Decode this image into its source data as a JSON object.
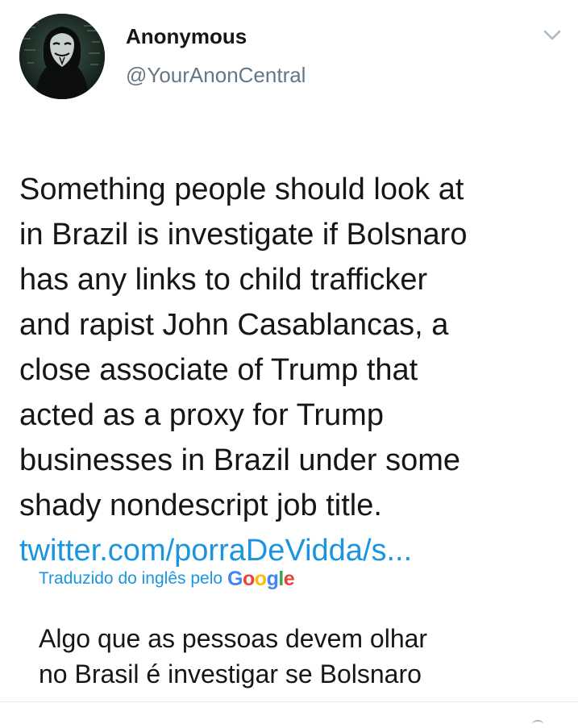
{
  "author": {
    "display_name": "Anonymous",
    "handle": "@YourAnonCentral",
    "avatar_icon": "anonymous-mask-avatar"
  },
  "menu": {
    "icon": "chevron-down-icon"
  },
  "tweet": {
    "text": "Something people should look at\nin Brazil is investigate if Bolsnaro\nhas any links to child trafficker\nand rapist John Casablancas, a\nclose associate of Trump that\nacted as a proxy for Trump\nbusinesses in Brazil under some\nshady nondescript job title.",
    "link": "twitter.com/porraDeVidda/s..."
  },
  "translation": {
    "label": "Traduzido do inglês pelo",
    "provider_letters": [
      "G",
      "o",
      "o",
      "g",
      "l",
      "e"
    ],
    "text": "Algo que as pessoas devem olhar\nno Brasil é investigar se Bolsnaro"
  },
  "colors": {
    "link": "#1b95e0",
    "secondary_text": "#657786",
    "divider": "#e1e8ed"
  }
}
